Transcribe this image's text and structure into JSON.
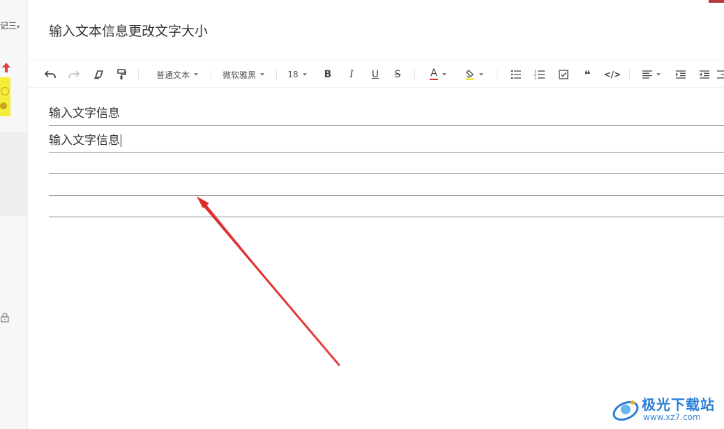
{
  "sidebar": {
    "top_label": "记三",
    "icons": [
      "arrow-up-icon",
      "sticker-icon",
      "lock-icon"
    ]
  },
  "document": {
    "title": "输入文本信息更改文字大小",
    "lines": [
      {
        "text": "输入文字信息"
      },
      {
        "text": "输入文字信息",
        "has_cursor": true
      },
      {
        "text": ""
      },
      {
        "text": ""
      },
      {
        "text": ""
      }
    ]
  },
  "toolbar": {
    "paragraph_style": "普通文本",
    "font_family": "微软雅黑",
    "font_size": "18",
    "bold_label": "B",
    "italic_label": "I",
    "underline_label": "U",
    "strike_label": "S",
    "font_color_label": "A",
    "font_color": "#d33b3b",
    "highlight_color": "#f3e52f",
    "quote_label": "❝",
    "code_label": "</>"
  },
  "annotation": {
    "arrow_color": "#e02a2a"
  },
  "watermark": {
    "name": "极光下载站",
    "url": "www.xz7.com"
  },
  "colors": {
    "accent_red": "#e02a2a",
    "watermark_blue": "#2a7fd4"
  }
}
